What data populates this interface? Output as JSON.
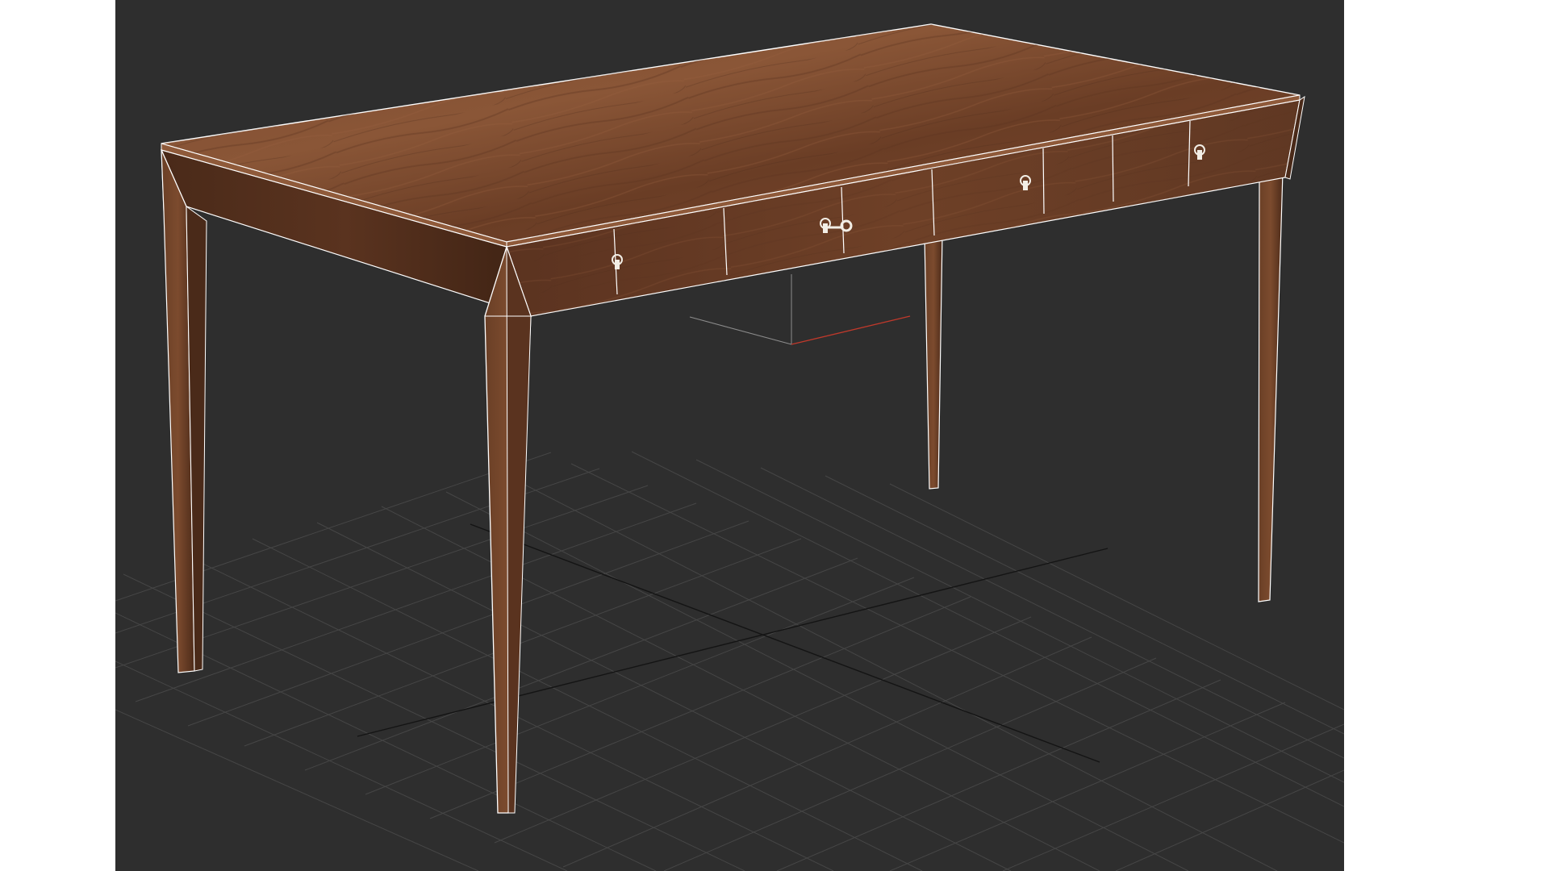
{
  "viewport": {
    "background_color": "#2e2e2e",
    "grid_color": "#4a4a4a",
    "grid_axis_color": "#111111",
    "selection_edge_color": "#ffffff",
    "pivot_x_color": "#c0392b",
    "pivot_other_color": "#9a9a9a"
  },
  "model": {
    "wood_light": "#7a4a30",
    "wood_mid": "#5e3621",
    "wood_dark": "#3d2316",
    "handle_color": "#f2eee6"
  }
}
